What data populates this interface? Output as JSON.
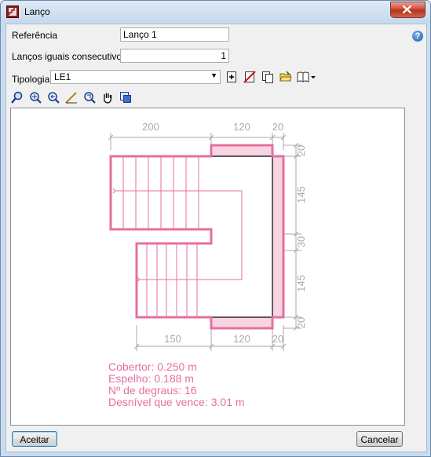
{
  "window": {
    "title": "Lanço"
  },
  "form": {
    "referencia_label": "Referência",
    "referencia_value": "Lanço 1",
    "lancos_label": "Lanços iguais consecutivos",
    "lancos_value": "1",
    "tipologia_label": "Tipologia",
    "tipologia_value": "LE1"
  },
  "help_label": "?",
  "toolbar_icons": [
    "new-icon",
    "delete-icon",
    "copy-icon",
    "open-folder-icon",
    "library-icon"
  ],
  "view_tools": [
    "zoom-window-icon",
    "zoom-extents-icon",
    "zoom-previous-icon",
    "measure-icon",
    "zoom-realtime-icon",
    "pan-icon",
    "view-3d-icon"
  ],
  "drawing": {
    "top_dims": [
      "200",
      "120",
      "20"
    ],
    "bottom_dims": [
      "150",
      "120",
      "20"
    ],
    "right_dims": [
      "20",
      "145",
      "30",
      "145",
      "20"
    ],
    "info": [
      "Cobertor: 0.250 m",
      "Espelho: 0.188 m",
      "Nº de degraus: 16",
      "Desnível que vence: 3.01 m"
    ],
    "stair_color": "#e56fa1",
    "dim_color": "#aaaaaa"
  },
  "buttons": {
    "ok": "Aceitar",
    "cancel": "Cancelar"
  }
}
